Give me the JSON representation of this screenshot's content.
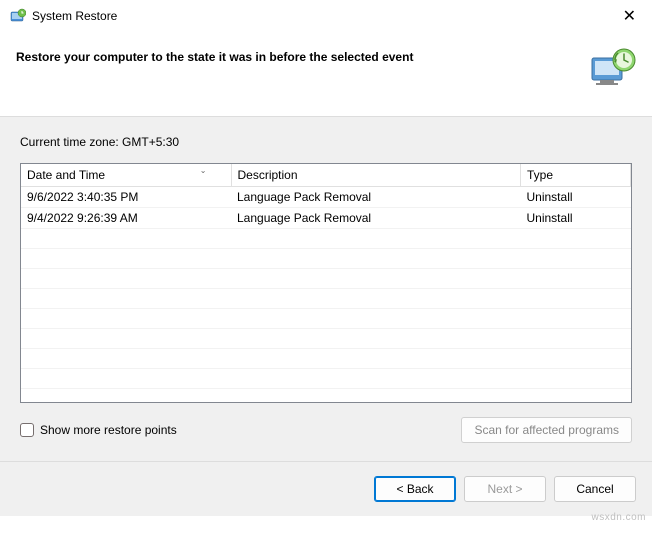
{
  "window": {
    "title": "System Restore",
    "close": "✕"
  },
  "header": {
    "heading": "Restore your computer to the state it was in before the selected event"
  },
  "timezone_label": "Current time zone: GMT+5:30",
  "table": {
    "columns": {
      "datetime": "Date and Time",
      "description": "Description",
      "type": "Type"
    },
    "rows": [
      {
        "datetime": "9/6/2022 3:40:35 PM",
        "description": "Language Pack Removal",
        "type": "Uninstall"
      },
      {
        "datetime": "9/4/2022 9:26:39 AM",
        "description": "Language Pack Removal",
        "type": "Uninstall"
      }
    ]
  },
  "show_more_label": "Show more restore points",
  "scan_button": "Scan for affected programs",
  "footer": {
    "back": "< Back",
    "next": "Next >",
    "cancel": "Cancel"
  },
  "watermark": "wsxdn.com"
}
